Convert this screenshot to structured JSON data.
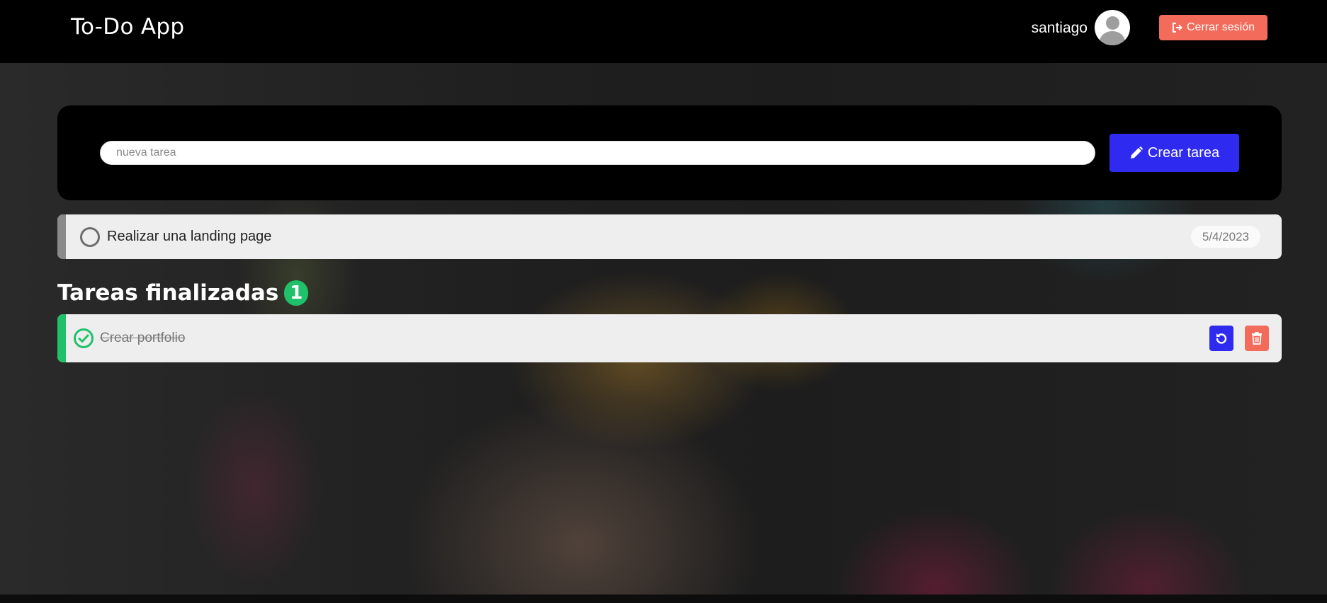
{
  "app": {
    "title": "To-Do App"
  },
  "header": {
    "username": "santiago",
    "logout_label": "Cerrar sesión"
  },
  "create": {
    "placeholder": "nueva tarea",
    "button_label": "Crear tarea"
  },
  "pending_tasks": [
    {
      "text": "Realizar una landing page",
      "date": "5/4/2023"
    }
  ],
  "finished": {
    "title": "Tareas finalizadas",
    "count": "1",
    "tasks": [
      {
        "text": "Crear portfolio"
      }
    ]
  },
  "colors": {
    "accent": "#2e2af0",
    "danger": "#f26b5b",
    "success": "#1fc16b",
    "navbar": "#000000"
  },
  "icons": {
    "logout": "sign-out-icon",
    "create": "pencil-icon",
    "pending_toggle": "circle-icon",
    "done_toggle": "check-circle-icon",
    "restore": "undo-icon",
    "delete": "trash-icon",
    "avatar": "user-avatar-icon"
  }
}
